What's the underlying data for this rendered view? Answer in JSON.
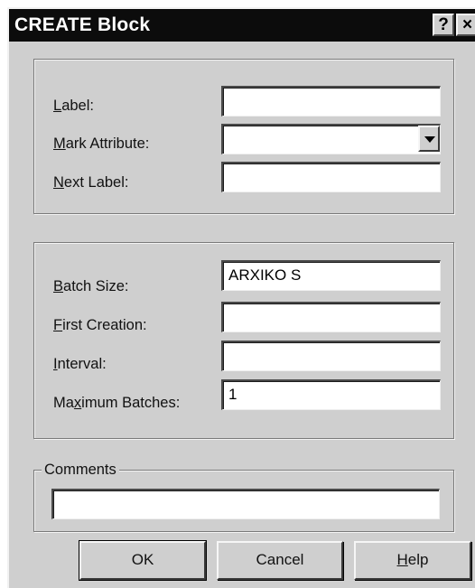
{
  "window": {
    "title": "CREATE Block",
    "help_button": "?",
    "close_button": "×"
  },
  "label_group": {
    "label": {
      "pre": "",
      "accel": "L",
      "post": "abel:",
      "value": ""
    },
    "mark_attribute": {
      "pre": "",
      "accel": "M",
      "post": "ark Attribute:",
      "value": ""
    },
    "next_label": {
      "pre": "",
      "accel": "N",
      "post": "ext Label:",
      "value": ""
    }
  },
  "batch_group": {
    "batch_size": {
      "pre": "",
      "accel": "B",
      "post": "atch Size:",
      "value": "ARXIKO S"
    },
    "first_creation": {
      "pre": "",
      "accel": "F",
      "post": "irst Creation:",
      "value": ""
    },
    "interval": {
      "pre": "",
      "accel": "I",
      "post": "nterval:",
      "value": ""
    },
    "maximum_batches": {
      "pre": "Ma",
      "accel": "x",
      "post": "imum Batches:",
      "value": "1"
    }
  },
  "comments_group": {
    "legend": "Comments",
    "value": ""
  },
  "buttons": {
    "ok": "OK",
    "cancel": "Cancel",
    "help": {
      "pre": "",
      "accel": "H",
      "post": "elp"
    }
  },
  "colors": {
    "titlebar": "#0c0c0c",
    "title_text": "#ffffff",
    "dialog_face": "#cfcfcf",
    "field_bg": "#ffffff"
  }
}
